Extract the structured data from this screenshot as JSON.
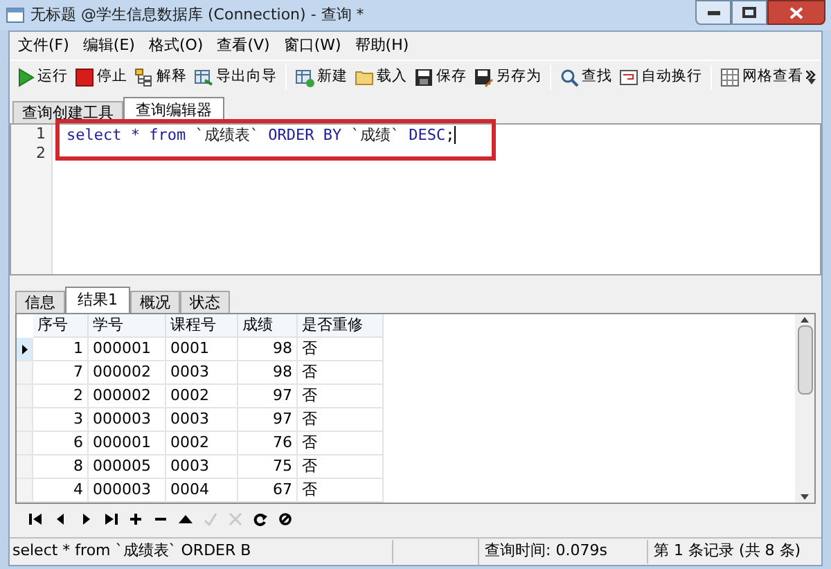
{
  "window": {
    "title": "无标题 @学生信息数据库 (Connection) - 查询 *"
  },
  "menu": [
    "文件(F)",
    "编辑(E)",
    "格式(O)",
    "查看(V)",
    "窗口(W)",
    "帮助(H)"
  ],
  "toolbar": [
    {
      "kind": "run",
      "label": "运行"
    },
    {
      "kind": "stop",
      "label": "停止"
    },
    {
      "kind": "explain",
      "label": "解释"
    },
    {
      "kind": "export",
      "label": "导出向导"
    },
    {
      "kind": "separator"
    },
    {
      "kind": "new",
      "label": "新建"
    },
    {
      "kind": "load",
      "label": "载入"
    },
    {
      "kind": "save",
      "label": "保存"
    },
    {
      "kind": "saveas",
      "label": "另存为"
    },
    {
      "kind": "separator"
    },
    {
      "kind": "find",
      "label": "查找"
    },
    {
      "kind": "wrap",
      "label": "自动换行"
    },
    {
      "kind": "separator"
    },
    {
      "kind": "grid",
      "label": "网格查看"
    }
  ],
  "editor_tabs": [
    {
      "label": "查询创建工具",
      "selected": false
    },
    {
      "label": "查询编辑器",
      "selected": true
    }
  ],
  "editor": {
    "lines": [
      {
        "number": "1",
        "tokens": [
          {
            "kind": "keyword",
            "text": "select"
          },
          {
            "kind": "keyword",
            "text": "*"
          },
          {
            "kind": "keyword",
            "text": "from"
          },
          {
            "kind": "ident",
            "text": "`成绩表`"
          },
          {
            "kind": "keyword",
            "text": "ORDER BY"
          },
          {
            "kind": "ident",
            "text": "`成绩`"
          },
          {
            "kind": "keyword",
            "text": "DESC"
          },
          {
            "kind": "plain",
            "text": ";"
          }
        ]
      },
      {
        "number": "2"
      }
    ]
  },
  "result_tabs": [
    {
      "label": "信息",
      "selected": false
    },
    {
      "label": "结果1",
      "selected": true
    },
    {
      "label": "概况",
      "selected": false
    },
    {
      "label": "状态",
      "selected": false
    }
  ],
  "table": {
    "columns": [
      "序号",
      "学号",
      "课程号",
      "成绩",
      "是否重修"
    ],
    "rows": [
      {
        "selected": true,
        "cells": [
          "1",
          "000001",
          "0001",
          "98",
          "否"
        ]
      },
      {
        "selected": false,
        "cells": [
          "7",
          "000002",
          "0003",
          "98",
          "否"
        ]
      },
      {
        "selected": false,
        "cells": [
          "2",
          "000002",
          "0002",
          "97",
          "否"
        ]
      },
      {
        "selected": false,
        "cells": [
          "3",
          "000003",
          "0003",
          "97",
          "否"
        ]
      },
      {
        "selected": false,
        "cells": [
          "6",
          "000001",
          "0002",
          "76",
          "否"
        ]
      },
      {
        "selected": false,
        "cells": [
          "8",
          "000005",
          "0003",
          "75",
          "否"
        ]
      },
      {
        "selected": false,
        "cells": [
          "4",
          "000003",
          "0004",
          "67",
          "否"
        ]
      }
    ]
  },
  "nav_buttons": [
    {
      "kind": "first",
      "disabled": false
    },
    {
      "kind": "prev",
      "disabled": false
    },
    {
      "kind": "next",
      "disabled": false
    },
    {
      "kind": "last",
      "disabled": false
    },
    {
      "kind": "add",
      "disabled": false
    },
    {
      "kind": "remove",
      "disabled": false
    },
    {
      "kind": "up",
      "disabled": false
    },
    {
      "kind": "apply",
      "disabled": true
    },
    {
      "kind": "cancel",
      "disabled": true
    },
    {
      "kind": "refresh",
      "disabled": false
    },
    {
      "kind": "stop",
      "disabled": false
    }
  ],
  "status_bar": {
    "sql": "select * from `成绩表` ORDER B",
    "query_time": "查询时间: 0.079s",
    "record": "第 1 条记录 (共 8 条)"
  }
}
